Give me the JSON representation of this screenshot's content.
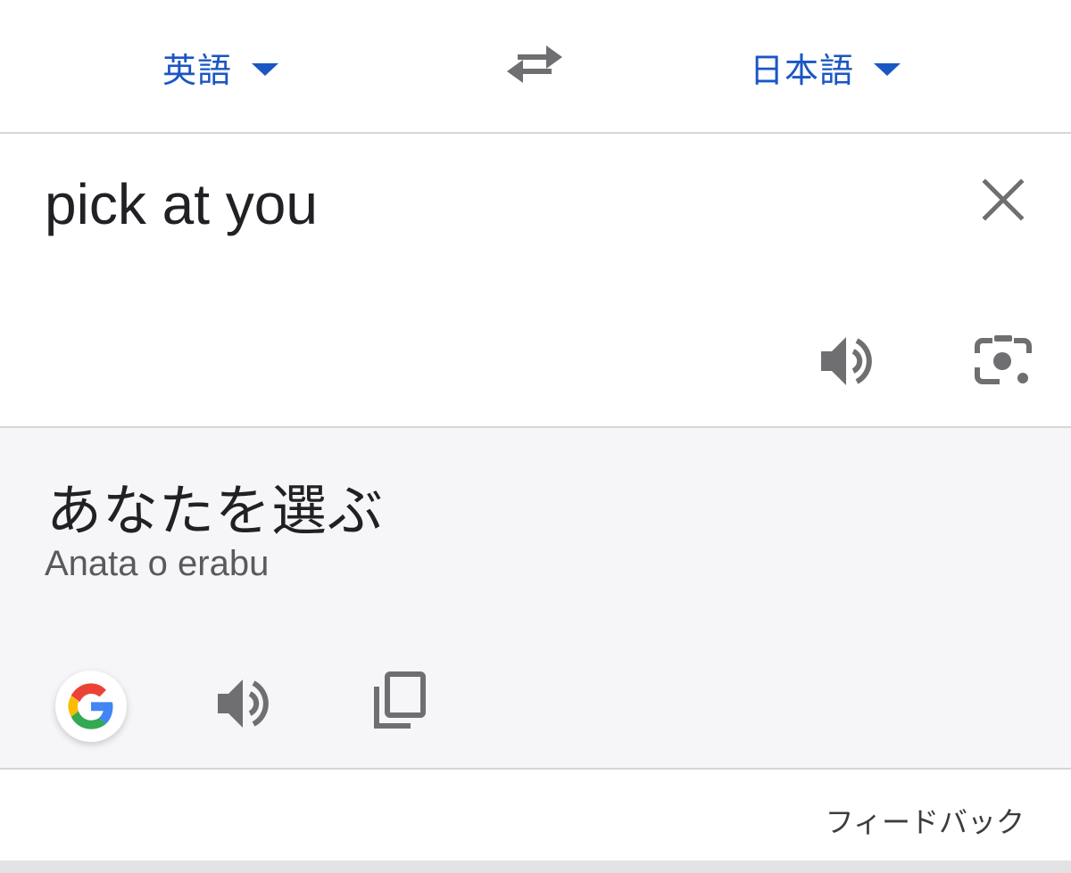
{
  "language_bar": {
    "source_language": "英語",
    "target_language": "日本語",
    "swap_icon": "swap-arrows-icon",
    "dropdown_icon": "caret-down-icon"
  },
  "source": {
    "text": "pick at you",
    "clear_icon": "close-icon",
    "speaker_icon": "speaker-icon",
    "camera_icon": "camera-lens-icon"
  },
  "translation": {
    "text": "あなたを選ぶ",
    "romanization": "Anata o erabu",
    "google_icon": "google-g-icon",
    "speaker_icon": "speaker-icon",
    "copy_icon": "copy-icon"
  },
  "footer": {
    "feedback_label": "フィードバック"
  },
  "colors": {
    "accent": "#1a56c4",
    "icon_gray": "#6f6f72",
    "translation_bg": "#f6f5f8"
  }
}
